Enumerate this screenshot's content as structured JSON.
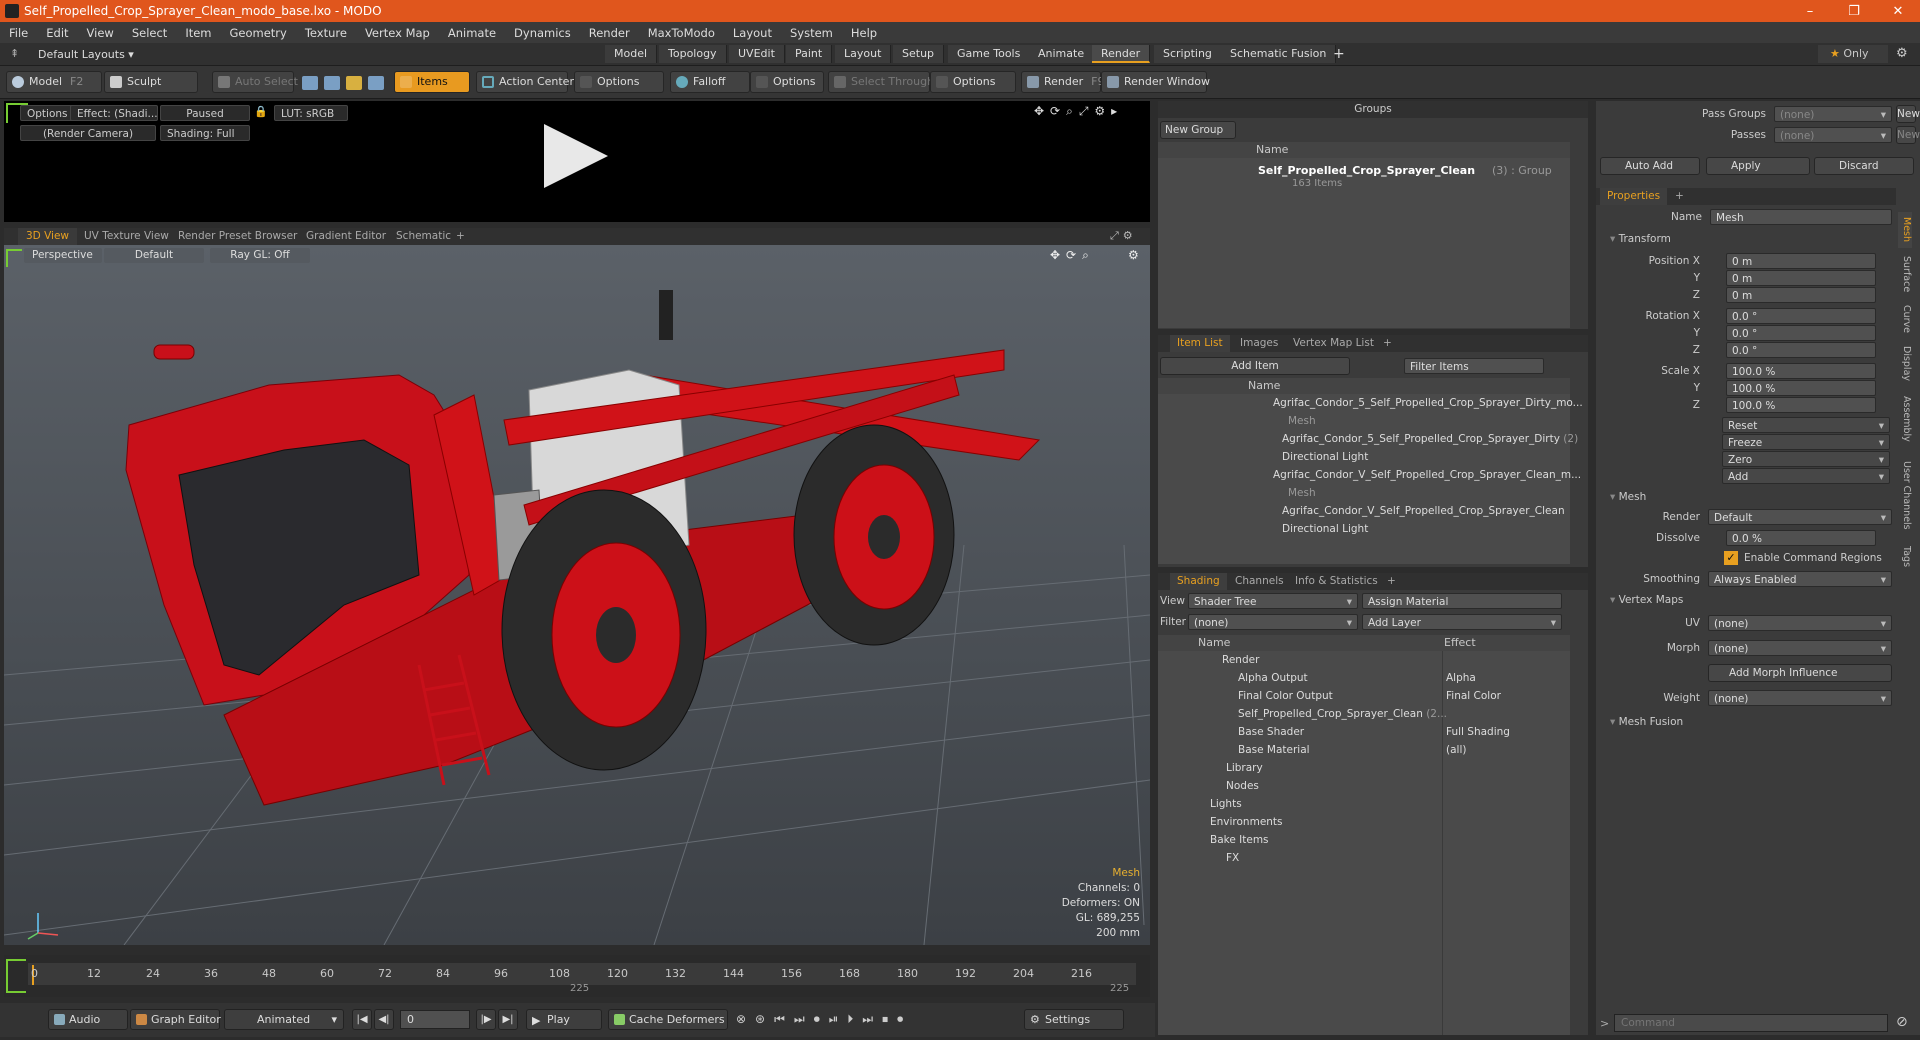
{
  "window": {
    "title": "Self_Propelled_Crop_Sprayer_Clean_modo_base.lxo - MODO",
    "min": "–",
    "max": "❐",
    "close": "✕"
  },
  "menu": [
    "File",
    "Edit",
    "View",
    "Select",
    "Item",
    "Geometry",
    "Texture",
    "Vertex Map",
    "Animate",
    "Dynamics",
    "Render",
    "MaxToModo",
    "Layout",
    "System",
    "Help"
  ],
  "layoutbar": {
    "layouts": "Default Layouts ▾",
    "tabs": [
      "Model",
      "Topology",
      "UVEdit",
      "Paint",
      "Layout",
      "Setup",
      "Game Tools",
      "Animate",
      "Render",
      "Scripting",
      "Schematic Fusion"
    ],
    "active": "Render",
    "plus": "+",
    "only": "Only"
  },
  "toolbar": {
    "model": "Model",
    "model_key": "F2",
    "sculpt": "Sculpt",
    "auto_select": "Auto Select",
    "items": "Items",
    "action_center": "Action Center",
    "options1": "Options",
    "falloff": "Falloff",
    "options2": "Options",
    "select_through": "Select Through",
    "options3": "Options",
    "render": "Render",
    "render_key": "F9",
    "render_window": "Render Window"
  },
  "preview": {
    "options": "Options",
    "effect": "Effect: (Shadi...",
    "paused": "Paused",
    "lut": "LUT: sRGB",
    "camera": "(Render Camera)",
    "shading": "Shading: Full"
  },
  "viewport": {
    "tabs": [
      "3D View",
      "UV Texture View",
      "Render Preset Browser",
      "Gradient Editor",
      "Schematic",
      "+"
    ],
    "perspective": "Perspective",
    "default": "Default",
    "raygl": "Ray GL: Off",
    "hud": {
      "title": "Mesh",
      "channels": "Channels: 0",
      "deformers": "Deformers: ON",
      "gl": "GL: 689,255",
      "scale": "200 mm"
    }
  },
  "colors": {
    "accent": "#e8a020",
    "titlebar": "#e0561d",
    "model_red": "#d01010"
  },
  "timeline": {
    "ticks": [
      "0",
      "12",
      "24",
      "36",
      "48",
      "60",
      "72",
      "84",
      "96",
      "108",
      "120",
      "132",
      "144",
      "156",
      "168",
      "180",
      "192",
      "204",
      "216"
    ],
    "end": "225",
    "mid": "225"
  },
  "bottom": {
    "audio": "Audio",
    "graph": "Graph Editor",
    "animated": "Animated",
    "frame": "0",
    "play": "Play",
    "cache": "Cache Deformers",
    "settings": "Settings"
  },
  "groups": {
    "title": "Groups",
    "new_group": "New Group",
    "col_name": "Name",
    "item_name": "Self_Propelled_Crop_Sprayer_Clean",
    "item_suffix": "(3) : Group",
    "item_count": "163 Items"
  },
  "itemlist": {
    "tabs": [
      "Item List",
      "Images",
      "Vertex Map List",
      "+"
    ],
    "add_item": "Add Item",
    "filter": "Filter Items",
    "col_name": "Name",
    "rows": [
      "Agrifac_Condor_5_Self_Propelled_Crop_Sprayer_Dirty_mo...",
      "Mesh",
      "Agrifac_Condor_5_Self_Propelled_Crop_Sprayer_Dirty",
      "Directional Light",
      "Agrifac_Condor_V_Self_Propelled_Crop_Sprayer_Clean_m...",
      "Mesh",
      "Agrifac_Condor_V_Self_Propelled_Crop_Sprayer_Clean",
      "Directional Light"
    ],
    "row_suffix": "(2)"
  },
  "shading": {
    "tabs": [
      "Shading",
      "Channels",
      "Info & Statistics",
      "+"
    ],
    "view_lbl": "View",
    "view": "Shader Tree",
    "assign": "Assign Material",
    "filter_lbl": "Filter",
    "filter": "(none)",
    "add_layer": "Add Layer",
    "col_name": "Name",
    "col_effect": "Effect",
    "rows": [
      {
        "name": "Render",
        "effect": ""
      },
      {
        "name": "Alpha Output",
        "effect": "Alpha"
      },
      {
        "name": "Final Color Output",
        "effect": "Final Color"
      },
      {
        "name": "Self_Propelled_Crop_Sprayer_Clean",
        "effect": ""
      },
      {
        "name": "Base Shader",
        "effect": "Full Shading"
      },
      {
        "name": "Base Material",
        "effect": "(all)"
      },
      {
        "name": "Library",
        "effect": ""
      },
      {
        "name": "Nodes",
        "effect": ""
      },
      {
        "name": "Lights",
        "effect": ""
      },
      {
        "name": "Environments",
        "effect": ""
      },
      {
        "name": "Bake Items",
        "effect": ""
      },
      {
        "name": "FX",
        "effect": ""
      }
    ],
    "row3_suffix": "(2..."
  },
  "passes": {
    "pass_groups": "Pass Groups",
    "passes": "Passes",
    "none": "(none)",
    "new": "New"
  },
  "cmds": {
    "auto_add": "Auto Add",
    "apply": "Apply",
    "discard": "Discard"
  },
  "props": {
    "tab": "Properties",
    "plus": "+",
    "name_lbl": "Name",
    "name": "Mesh",
    "transform": "Transform",
    "pos_x": "Position X",
    "y": "Y",
    "z": "Z",
    "rot_x": "Rotation X",
    "scale_x": "Scale X",
    "pos": [
      "0 m",
      "0 m",
      "0 m"
    ],
    "rot": [
      "0.0 °",
      "0.0 °",
      "0.0 °"
    ],
    "scale": [
      "100.0 %",
      "100.0 %",
      "100.0 %"
    ],
    "reset": "Reset",
    "freeze": "Freeze",
    "zero": "Zero",
    "add": "Add",
    "mesh": "Mesh",
    "render_lbl": "Render",
    "render": "Default",
    "dissolve_lbl": "Dissolve",
    "dissolve": "0.0 %",
    "enable_cmd": "Enable Command Regions",
    "smoothing_lbl": "Smoothing",
    "smoothing": "Always Enabled",
    "vertex_maps": "Vertex Maps",
    "uv_lbl": "UV",
    "uv": "(none)",
    "morph_lbl": "Morph",
    "morph": "(none)",
    "add_morph": "Add Morph Influence",
    "weight_lbl": "Weight",
    "weight": "(none)",
    "mesh_fusion": "Mesh Fusion",
    "side_tabs": [
      "Mesh",
      "Surface",
      "Curve",
      "Display",
      "Assembly",
      "User Channels",
      "Tags"
    ]
  },
  "command": {
    "placeholder": "Command",
    "prompt": ">"
  }
}
